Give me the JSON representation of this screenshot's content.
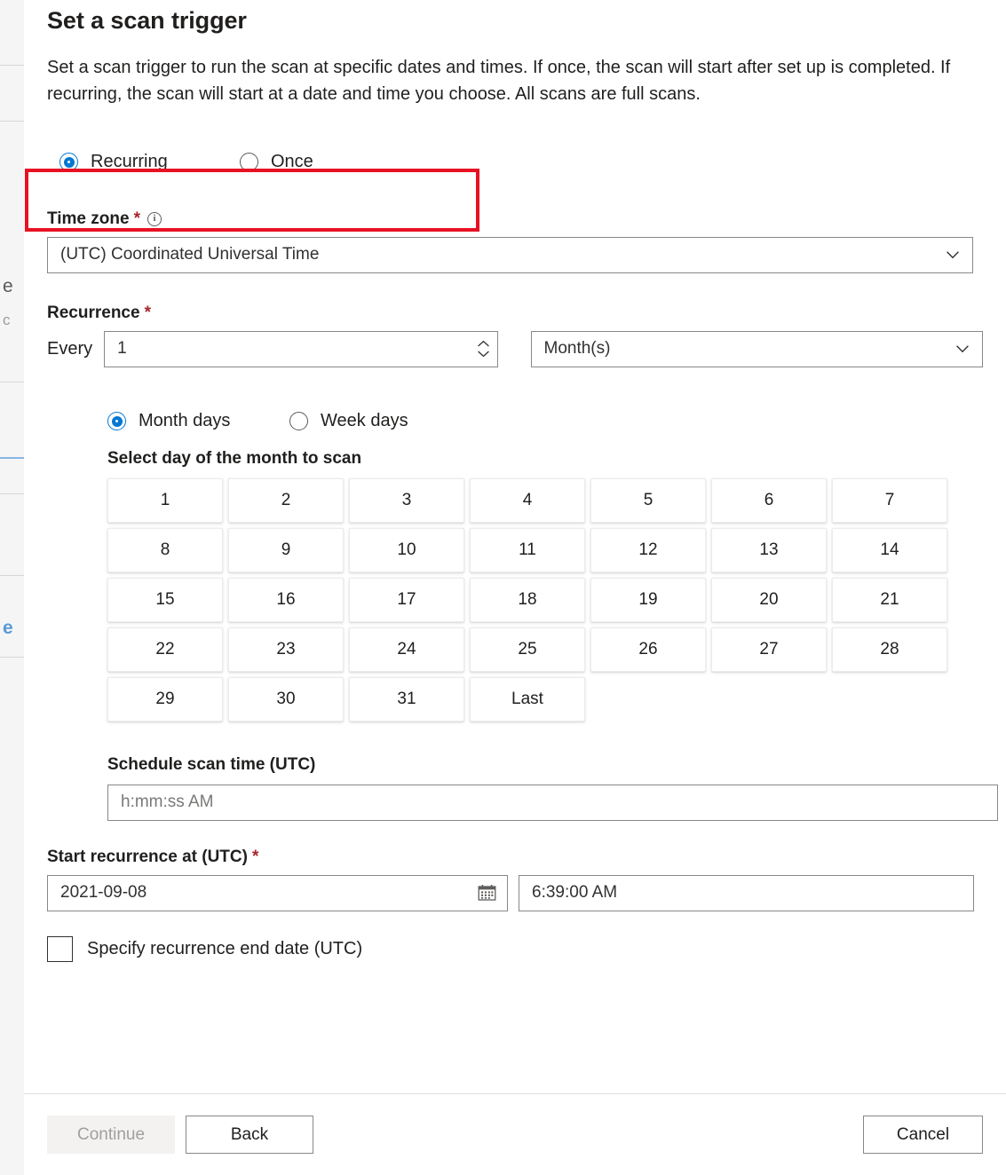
{
  "background_strip": {
    "fragments": [
      {
        "text": "e",
        "kind": "dark"
      },
      {
        "text": "c",
        "kind": "muted"
      },
      {
        "text": "e",
        "kind": "link"
      }
    ]
  },
  "panel": {
    "title": "Set a scan trigger",
    "description": "Set a scan trigger to run the scan at specific dates and times. If once, the scan will start after set up is completed. If recurring, the scan will start at a date and time you choose. All scans are full scans."
  },
  "trigger_mode": {
    "options": [
      {
        "label": "Recurring",
        "selected": true
      },
      {
        "label": "Once",
        "selected": false
      }
    ]
  },
  "time_zone": {
    "label": "Time zone",
    "required_marker": "*",
    "info_glyph": "i",
    "value": "(UTC) Coordinated Universal Time"
  },
  "recurrence": {
    "label": "Recurrence",
    "required_marker": "*",
    "every_label": "Every",
    "interval_value": "1",
    "unit_value": "Month(s)"
  },
  "day_mode": {
    "options": [
      {
        "label": "Month days",
        "selected": true
      },
      {
        "label": "Week days",
        "selected": false
      }
    ]
  },
  "month_days": {
    "heading": "Select day of the month to scan",
    "cells": [
      "1",
      "2",
      "3",
      "4",
      "5",
      "6",
      "7",
      "8",
      "9",
      "10",
      "11",
      "12",
      "13",
      "14",
      "15",
      "16",
      "17",
      "18",
      "19",
      "20",
      "21",
      "22",
      "23",
      "24",
      "25",
      "26",
      "27",
      "28",
      "29",
      "30",
      "31",
      "Last"
    ]
  },
  "schedule_time": {
    "label": "Schedule scan time (UTC)",
    "placeholder": "h:mm:ss AM",
    "value": ""
  },
  "start_recurrence": {
    "label": "Start recurrence at (UTC)",
    "required_marker": "*",
    "date_value": "2021-09-08",
    "time_value": "6:39:00 AM"
  },
  "end_date_checkbox": {
    "label": "Specify recurrence end date (UTC)",
    "checked": false
  },
  "footer": {
    "continue_label": "Continue",
    "continue_disabled": true,
    "back_label": "Back",
    "cancel_label": "Cancel"
  },
  "colors": {
    "accent": "#0078d4",
    "required": "#a4262c",
    "highlight": "#e81123",
    "text": "#201f1e"
  }
}
